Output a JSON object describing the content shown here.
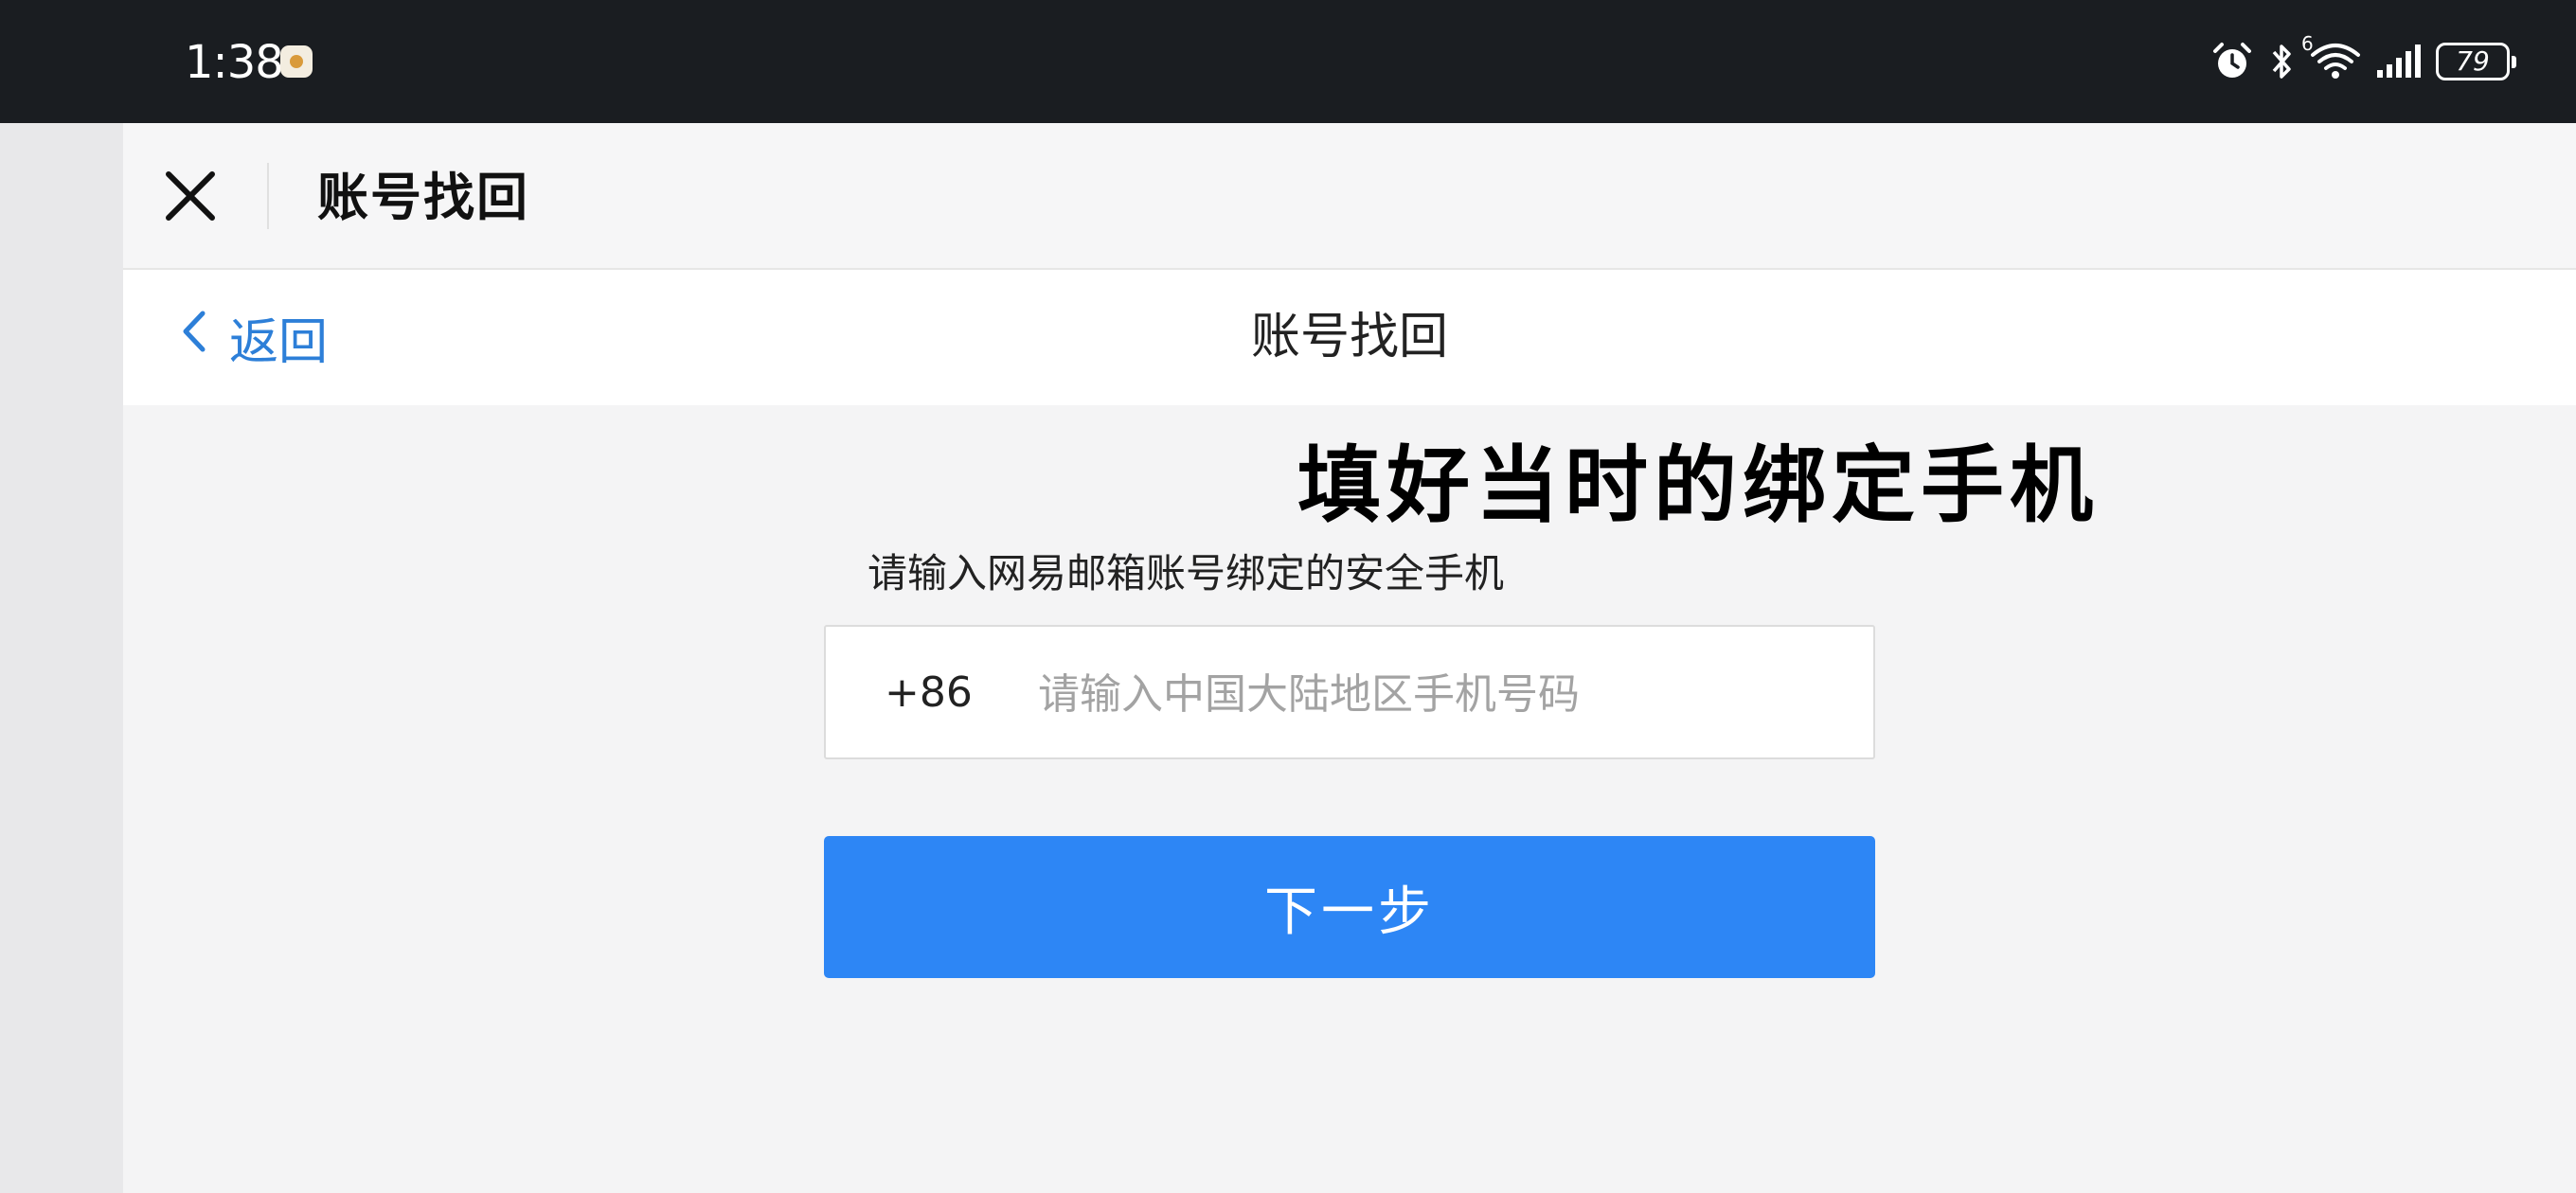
{
  "status_bar": {
    "time": "1:38",
    "network_label": "6",
    "battery": "79"
  },
  "toolbar": {
    "title": "账号找回"
  },
  "nav": {
    "back_label": "返回",
    "title": "账号找回"
  },
  "annotation": {
    "text": "填好当时的绑定手机"
  },
  "form": {
    "prompt": "请输入网易邮箱账号绑定的安全手机",
    "country_code": "+86",
    "phone_value": "",
    "phone_placeholder": "请输入中国大陆地区手机号码",
    "next_label": "下一步"
  },
  "colors": {
    "status_bar_bg": "#1a1d21",
    "link_blue": "#2d7fd8",
    "primary_button": "#2d86f5",
    "page_bg": "#f4f4f5"
  },
  "icons": [
    "app-badge-icon",
    "alarm-icon",
    "bluetooth-icon",
    "wifi-icon",
    "signal-icon",
    "battery-icon",
    "close-icon",
    "chevron-left-icon"
  ]
}
